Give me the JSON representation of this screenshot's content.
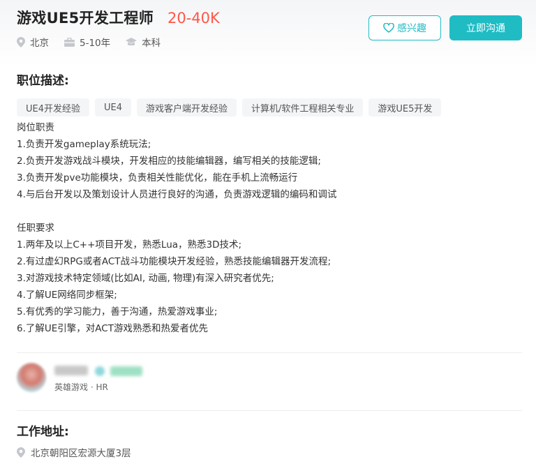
{
  "job": {
    "title": "游戏UE5开发工程师",
    "salary": "20-40K",
    "city": "北京",
    "experience": "5-10年",
    "education": "本科"
  },
  "actions": {
    "interest_label": "感兴趣",
    "chat_label": "立即沟通"
  },
  "description": {
    "section_title": "职位描述:",
    "tags": [
      "UE4开发经验",
      "UE4",
      "游戏客户端开发经验",
      "计算机/软件工程相关专业",
      "游戏UE5开发"
    ],
    "lines": [
      "岗位职责",
      "1.负责开发gameplay系统玩法;",
      "2.负责开发游戏战斗模块，开发相应的技能编辑器，编写相关的技能逻辑;",
      "3.负责开发pve功能模块，负责相关性能优化，能在手机上流畅运行",
      "4.与后台开发以及策划设计人员进行良好的沟通，负责游戏逻辑的编码和调试",
      "",
      "任职要求",
      "1.两年及以上C++项目开发，熟悉Lua，熟悉3D技术;",
      "2.有过虚幻RPG或者ACT战斗功能模块开发经验，熟悉技能编辑器开发流程;",
      "3.对游戏技术特定领域(比如AI, 动画, 物理)有深入研究者优先;",
      "4.了解UE网络同步框架;",
      "5.有优秀的学习能力，善于沟通，热爱游戏事业;",
      "6.了解UE引擎，对ACT游戏熟悉和热爱者优先"
    ]
  },
  "recruiter": {
    "company_role": "英雄游戏 · HR"
  },
  "location": {
    "section_title": "工作地址:",
    "address": "北京朝阳区宏源大厦3层"
  },
  "colors": {
    "accent": "#1fbcc4",
    "salary": "#fe574a"
  }
}
